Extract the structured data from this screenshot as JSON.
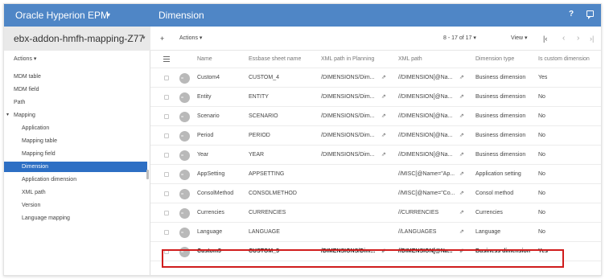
{
  "topbar": {
    "app_title": "Oracle Hyperion EPM",
    "app_caret": "▾",
    "page_title": "Dimension",
    "help_icon": "?",
    "chat_icon": "chat-icon"
  },
  "sidebar": {
    "dataspace": "ebx-addon-hmfh-mapping-Z77",
    "dataspace_caret": "▾",
    "actions_label": "Actions ▾",
    "items": [
      {
        "label": "MDM table"
      },
      {
        "label": "MDM field"
      },
      {
        "label": "Path"
      },
      {
        "label": "Mapping",
        "caret": "▾"
      },
      {
        "label": "Application"
      },
      {
        "label": "Mapping table"
      },
      {
        "label": "Mapping field"
      },
      {
        "label": "Dimension"
      },
      {
        "label": "Application dimension"
      },
      {
        "label": "XML path"
      },
      {
        "label": "Version"
      },
      {
        "label": "Language mapping"
      }
    ]
  },
  "toolbar": {
    "add_label": "+",
    "actions_label": "Actions ▾",
    "pagination": "8 - 17 of 17 ▾",
    "view_label": "View ▾",
    "first_icon": "|‹",
    "prev_icon": "‹",
    "next_icon": "›",
    "last_icon": "›|"
  },
  "table": {
    "columns": [
      "Name",
      "Essbase sheet name",
      "XML path in Planning",
      "XML path",
      "Dimension type",
      "Is custom dimension"
    ],
    "link_icon": "⇗",
    "rows": [
      {
        "name": "Custom4",
        "sheet": "CUSTOM_4",
        "planning": "/DIMENSIONS/Dim...",
        "xml": "//DIMENSION[@Na...",
        "type": "Business dimension",
        "custom": "Yes"
      },
      {
        "name": "Entity",
        "sheet": "ENTITY",
        "planning": "/DIMENSIONS/Dim...",
        "xml": "//DIMENSION[@Na...",
        "type": "Business dimension",
        "custom": "No"
      },
      {
        "name": "Scenario",
        "sheet": "SCENARIO",
        "planning": "/DIMENSIONS/Dim...",
        "xml": "//DIMENSION[@Na...",
        "type": "Business dimension",
        "custom": "No"
      },
      {
        "name": "Period",
        "sheet": "PERIOD",
        "planning": "/DIMENSIONS/Dim...",
        "xml": "//DIMENSION[@Na...",
        "type": "Business dimension",
        "custom": "No"
      },
      {
        "name": "Year",
        "sheet": "YEAR",
        "planning": "/DIMENSIONS/Dim...",
        "xml": "//DIMENSION[@Na...",
        "type": "Business dimension",
        "custom": "No"
      },
      {
        "name": "AppSetting",
        "sheet": "APPSETTING",
        "planning": "",
        "xml": "//MISC[@Name=\"Ap...",
        "type": "Application setting",
        "custom": "No"
      },
      {
        "name": "ConsolMethod",
        "sheet": "CONSOLMETHOD",
        "planning": "",
        "xml": "//MISC[@Name=\"Co...",
        "type": "Consol method",
        "custom": "No"
      },
      {
        "name": "Currencies",
        "sheet": "CURRENCIES",
        "planning": "",
        "xml": "//CURRENCIES",
        "type": "Currencies",
        "custom": "No"
      },
      {
        "name": "Language",
        "sheet": "LANGUAGE",
        "planning": "",
        "xml": "//LANGUAGES",
        "type": "Language",
        "custom": "No"
      },
      {
        "name": "Custom5",
        "sheet": "CUSTOM_5",
        "planning": "/DIMENSIONS/Dim...",
        "xml": "//DIMENSION[@Na...",
        "type": "Business dimension",
        "custom": "Yes"
      }
    ]
  },
  "colors": {
    "topbar": "#4f86c6",
    "active_nav": "#2d6fc4",
    "highlight": "#d01c1c"
  }
}
